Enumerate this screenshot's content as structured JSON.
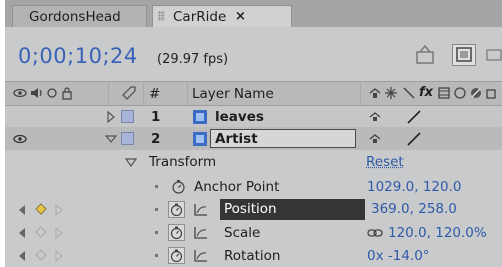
{
  "tabs": [
    {
      "label": "GordonsHead"
    },
    {
      "label": "CarRide"
    }
  ],
  "tab_close_glyph": "×",
  "timecode": "0;00;10;24",
  "fps": "(29.97 fps)",
  "columns": {
    "number": "#",
    "layer_name": "Layer Name",
    "fx": "fx"
  },
  "layers": [
    {
      "number": "1",
      "name": "leaves"
    },
    {
      "number": "2",
      "name": "Artist"
    }
  ],
  "transform": {
    "label": "Transform",
    "reset": "Reset",
    "properties": [
      {
        "name": "Anchor Point",
        "value": "1029.0, 120.0"
      },
      {
        "name": "Position",
        "value": "369.0, 258.0"
      },
      {
        "name": "Scale",
        "value": "120.0, 120.0%"
      },
      {
        "name": "Rotation",
        "value": "0x -14.0°"
      }
    ]
  },
  "icons": [
    "eye-icon",
    "speaker-icon",
    "solo-icon",
    "lock-icon",
    "label-tag-icon",
    "twirl-triangle-icon",
    "composition-layer-icon",
    "stopwatch-icon",
    "graph-icon",
    "keyframe-diamond-icon",
    "chain-link-icon",
    "shy-icon",
    "collapse-icon",
    "quality-icon",
    "motion-blur-icon"
  ],
  "colors": {
    "timecode": "#3a63b8",
    "value_text": "#2f5aa8",
    "label_swatch": "#a9b5d8",
    "keyframe": "#e8c44a"
  }
}
